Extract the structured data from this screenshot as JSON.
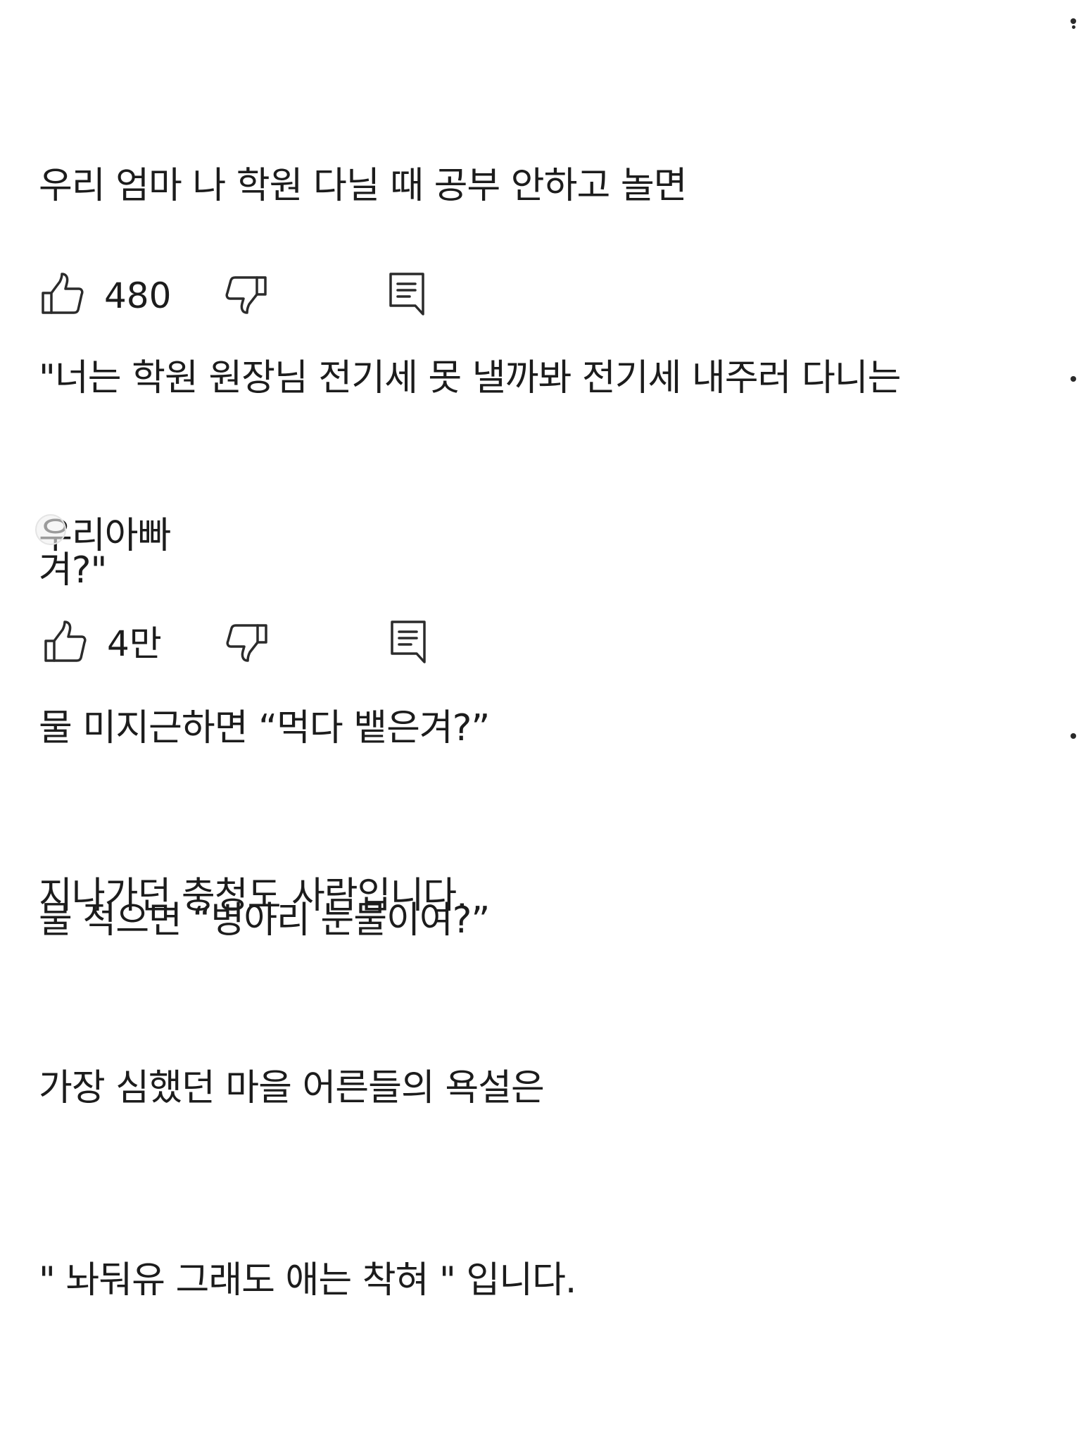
{
  "comments": [
    {
      "lines": [
        "우리 엄마 나 학원 다닐 때 공부 안하고 놀면",
        "\"너는 학원 원장님 전기세 못 낼까봐 전기세 내주러 다니는",
        "겨?\""
      ],
      "likes": "480"
    },
    {
      "lines": [
        "우리아빠",
        "물 미지근하면 “먹다 뱉은겨?”",
        "물 적으면 “병아리 눈물이여?”"
      ],
      "likes": "4만"
    },
    {
      "lines": [
        "지나가던 충청도 사람입니다.",
        "가장 심했던 마을 어른들의 욕설은",
        "\" 놔둬유 그래도 애는 착혀 \" 입니다."
      ]
    }
  ],
  "icons": {
    "like": "thumbs-up-icon",
    "dislike": "thumbs-down-icon",
    "reply": "comment-reply-icon",
    "more": "more-options-icon"
  },
  "colors": {
    "text": "#1c1c1c",
    "icon": "#2b2b2b",
    "background": "#ffffff"
  }
}
